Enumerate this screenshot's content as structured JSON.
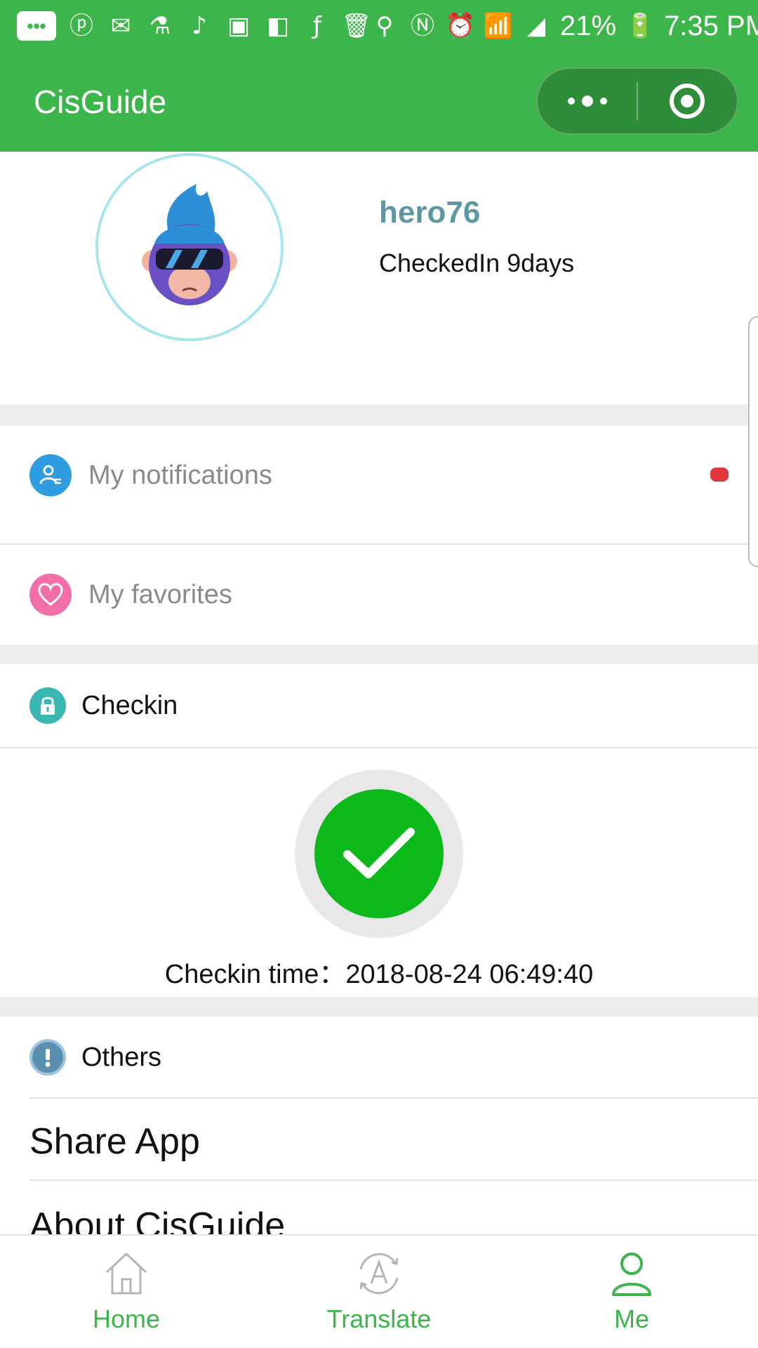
{
  "status_bar": {
    "battery": "21%",
    "time": "7:35 PM",
    "icons": [
      "chat-bubble-icon",
      "pinterest-icon",
      "gmail-icon",
      "lab-flask-icon",
      "tiktok-icon",
      "image-icon",
      "flipboard-icon",
      "facebook-icon",
      "trash-icon",
      "location-icon",
      "nfc-icon",
      "alarm-icon",
      "wifi-icon",
      "cell-signal-icon",
      "battery-charging-icon"
    ]
  },
  "app_bar": {
    "title": "CisGuide",
    "menu_icon": "more-dots-icon",
    "close_icon": "target-circle-icon"
  },
  "profile": {
    "username": "hero76",
    "checkin_days": "CheckedIn 9days",
    "avatar_icon": "monkey-sunglasses-avatar"
  },
  "menu": {
    "notifications_label": "My notifications",
    "favorites_label": "My favorites",
    "notification_badge": "unread-red-dot",
    "colors": {
      "notifications_icon": "#2f9be0",
      "favorites_icon": "#f26ea8",
      "badge": "#e0373d"
    }
  },
  "checkin": {
    "section_title": "Checkin",
    "section_icon": "lock-icon",
    "status_icon": "checkmark-icon",
    "time_text": "Checkin time：2018-08-24 06:49:40",
    "colors": {
      "check_fill": "#0db81b",
      "ring": "#e8e8e8"
    }
  },
  "others": {
    "section_title": "Others",
    "section_icon": "info-icon",
    "share_label": "Share App",
    "about_label": "About CisGuide"
  },
  "tabs": [
    {
      "label": "Home",
      "icon": "home-icon"
    },
    {
      "label": "Translate",
      "icon": "translate-icon"
    },
    {
      "label": "Me",
      "icon": "person-icon",
      "active": true
    }
  ],
  "theme": {
    "brand": "#3cb54a",
    "brand_dark": "#2f8c38",
    "page_gap": "#ededed"
  }
}
